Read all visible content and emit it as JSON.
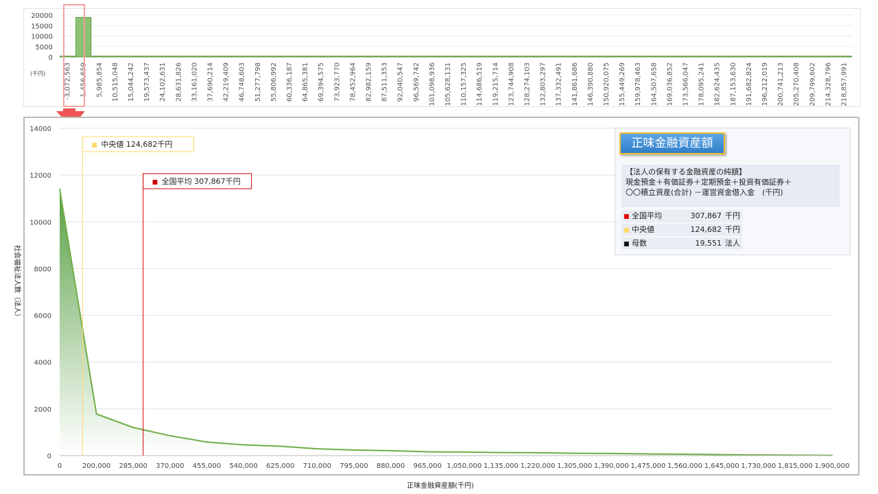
{
  "top_chart": {
    "unit_label": "(千円)",
    "y_ticks": [
      0,
      5000,
      10000,
      15000,
      20000
    ],
    "x_tick_labels": [
      "-3,072,563",
      "1,456,659",
      "5,985,854",
      "10,515,048",
      "15,044,242",
      "19,573,437",
      "24,102,631",
      "28,631,826",
      "33,161,020",
      "37,690,214",
      "42,219,409",
      "46,748,603",
      "51,277,798",
      "55,806,992",
      "60,336,187",
      "64,865,381",
      "69,394,575",
      "73,923,770",
      "78,452,964",
      "82,982,159",
      "87,511,353",
      "92,040,547",
      "96,569,742",
      "101,098,936",
      "105,628,131",
      "110,157,325",
      "114,686,519",
      "119,215,714",
      "123,744,908",
      "128,274,103",
      "132,803,297",
      "137,332,491",
      "141,861,686",
      "146,390,880",
      "150,920,075",
      "155,449,269",
      "159,978,463",
      "164,507,658",
      "169,036,852",
      "173,566,047",
      "178,095,241",
      "182,624,435",
      "187,153,630",
      "191,682,824",
      "196,212,019",
      "200,741,213",
      "205,270,408",
      "209,799,602",
      "214,328,796",
      "218,857,991"
    ]
  },
  "chart_data": [
    {
      "type": "bar",
      "description_unit": "千円",
      "categories": [
        "-3,072,563",
        "1,456,659",
        "5,985,854",
        "10,515,048",
        "15,044,242",
        "19,573,437",
        "24,102,631",
        "28,631,826",
        "33,161,020",
        "37,690,214",
        "42,219,409",
        "46,748,603",
        "51,277,798",
        "55,806,992",
        "60,336,187",
        "64,865,381",
        "69,394,575",
        "73,923,770",
        "78,452,964",
        "82,982,159",
        "87,511,353",
        "92,040,547",
        "96,569,742",
        "101,098,936",
        "105,628,131",
        "110,157,325",
        "114,686,519",
        "119,215,714",
        "123,744,908",
        "128,274,103",
        "132,803,297",
        "137,332,491",
        "141,861,686",
        "146,390,880",
        "150,920,075",
        "155,449,269",
        "159,978,463",
        "164,507,658",
        "169,036,852",
        "173,566,047",
        "178,095,241",
        "182,624,435",
        "187,153,630",
        "191,682,824",
        "196,212,019",
        "200,741,213",
        "205,270,408",
        "209,799,602",
        "214,328,796",
        "218,857,991"
      ],
      "values": [
        200,
        18900,
        350,
        120,
        60,
        50,
        0,
        30,
        0,
        20,
        0,
        0,
        0,
        0,
        0,
        0,
        0,
        0,
        0,
        0,
        0,
        0,
        0,
        0,
        0,
        0,
        0,
        0,
        0,
        0,
        0,
        0,
        0,
        0,
        0,
        0,
        0,
        0,
        0,
        0,
        0,
        0,
        0,
        0,
        0,
        0,
        0,
        0,
        0,
        10
      ],
      "ylim": [
        0,
        20000
      ]
    },
    {
      "type": "area",
      "xlabel": "正味金融資産額(千円)",
      "ylabel": "社会福祉法人数（法人）",
      "x_tick_labels": [
        "0",
        "200,000",
        "285,000",
        "370,000",
        "455,000",
        "540,000",
        "625,000",
        "710,000",
        "795,000",
        "880,000",
        "965,000",
        "1,050,000",
        "1,135,000",
        "1,220,000",
        "1,305,000",
        "1,390,000",
        "1,475,000",
        "1,560,000",
        "1,645,000",
        "1,730,000",
        "1,815,000",
        "1,900,000"
      ],
      "y_ticks": [
        0,
        2000,
        4000,
        6000,
        8000,
        10000,
        12000,
        14000
      ],
      "ylim": [
        0,
        14000
      ],
      "values": [
        11400,
        1780,
        1200,
        850,
        580,
        460,
        400,
        290,
        240,
        210,
        160,
        150,
        130,
        120,
        100,
        90,
        70,
        60,
        40,
        30,
        20,
        10
      ],
      "color": "#70ad47",
      "reference_lines": [
        {
          "label": "中央値",
          "value_text": "124,682千円",
          "x_value": 124682,
          "color": "#ffd966"
        },
        {
          "label": "全国平均",
          "value_text": "307,867千円",
          "x_value": 307867,
          "color": "#cc0000"
        }
      ],
      "grid": true
    }
  ],
  "info": {
    "title": "正味金融資産額",
    "desc_lines": [
      "【法人の保有する金融資産の純額】",
      "現金預金＋有価証券＋定期預金＋投資有価証券＋",
      "〇〇積立資産(合計) －運営資金借入金　(千円)"
    ],
    "stats": [
      {
        "label": "全国平均",
        "value": "307,867",
        "unit": "千円",
        "color": "#e00000"
      },
      {
        "label": "中央値",
        "value": "124,682",
        "unit": "千円",
        "color": "#ffd966"
      },
      {
        "label": "母数",
        "value": "19,551",
        "unit": "法人",
        "color": "#111111"
      }
    ]
  }
}
